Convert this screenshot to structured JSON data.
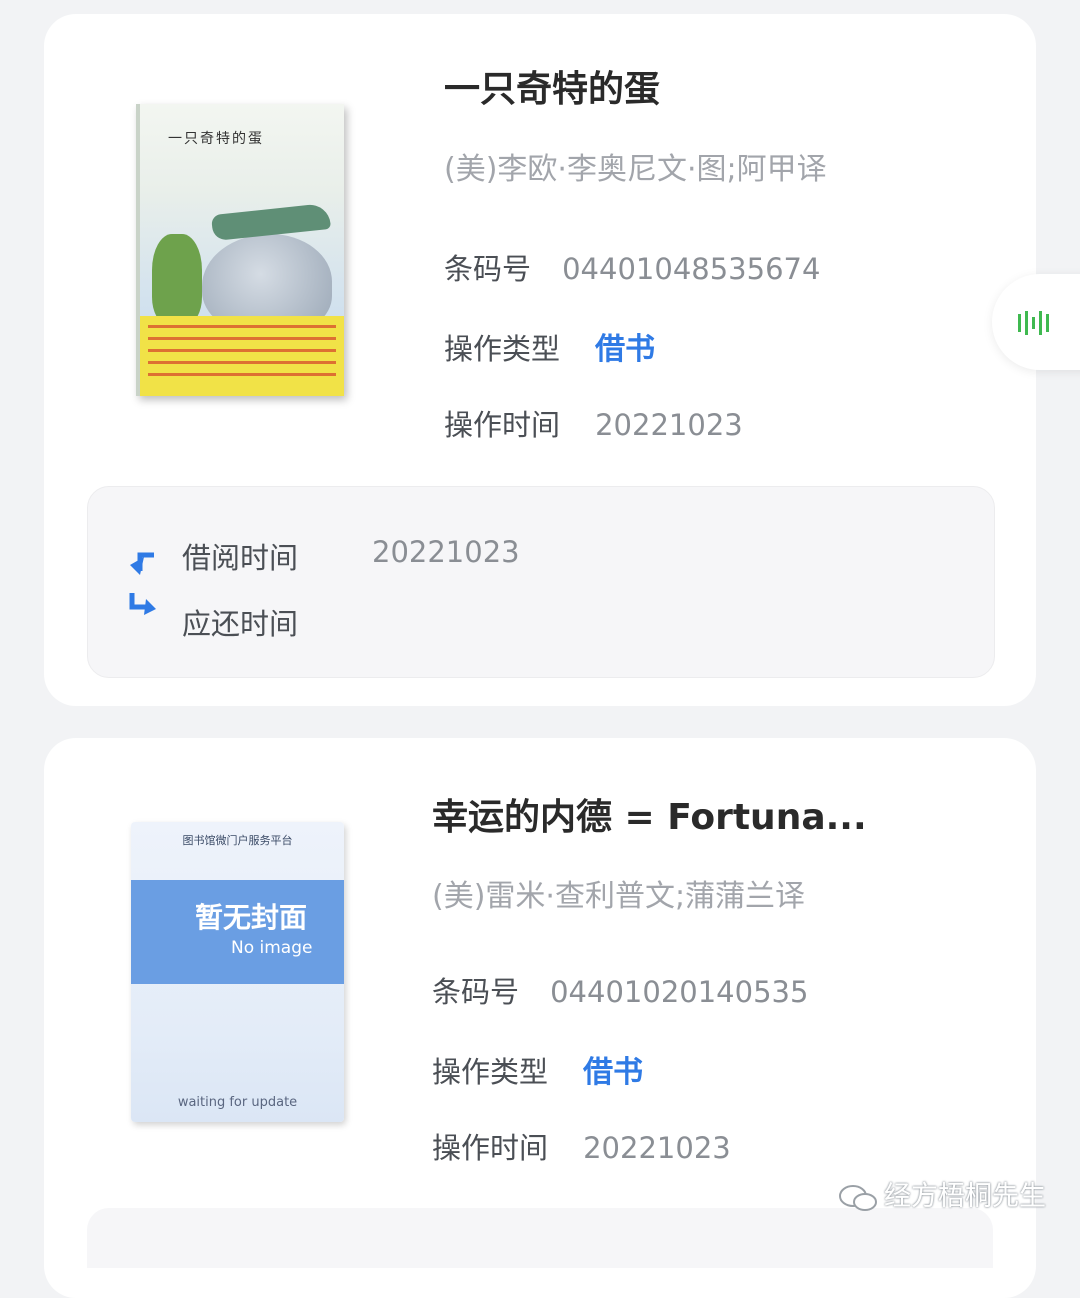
{
  "books": [
    {
      "title": "一只奇特的蛋",
      "author": "(美)李欧·李奥尼文·图;阿甲译",
      "barcode_label": "条码号",
      "barcode": "04401048535674",
      "op_type_label": "操作类型",
      "op_type": "借书",
      "op_time_label": "操作时间",
      "op_time": "20221023",
      "cover": {
        "title": "一只奇特的蛋"
      },
      "loan": {
        "borrow_label": "借阅时间",
        "borrow_time": "20221023",
        "due_label": "应还时间",
        "due_time": ""
      }
    },
    {
      "title": "幸运的内德 = Fortuna...",
      "author": "(美)雷米·查利普文;蒲蒲兰译",
      "barcode_label": "条码号",
      "barcode": "04401020140535",
      "op_type_label": "操作类型",
      "op_type": "借书",
      "op_time_label": "操作时间",
      "op_time": "20221023",
      "cover": {
        "platform": "图书馆微门户服务平台",
        "no_image_cn": "暂无封面",
        "no_image_en": "No image",
        "waiting": "waiting for update"
      }
    }
  ],
  "side_button": {
    "icon": "barcode-scan-icon"
  },
  "watermark": {
    "text": "经方梧桐先生",
    "icon": "wechat-icon"
  },
  "colors": {
    "accent": "#2f7ae5",
    "scan_green": "#3fb950",
    "background": "#f2f3f5"
  }
}
